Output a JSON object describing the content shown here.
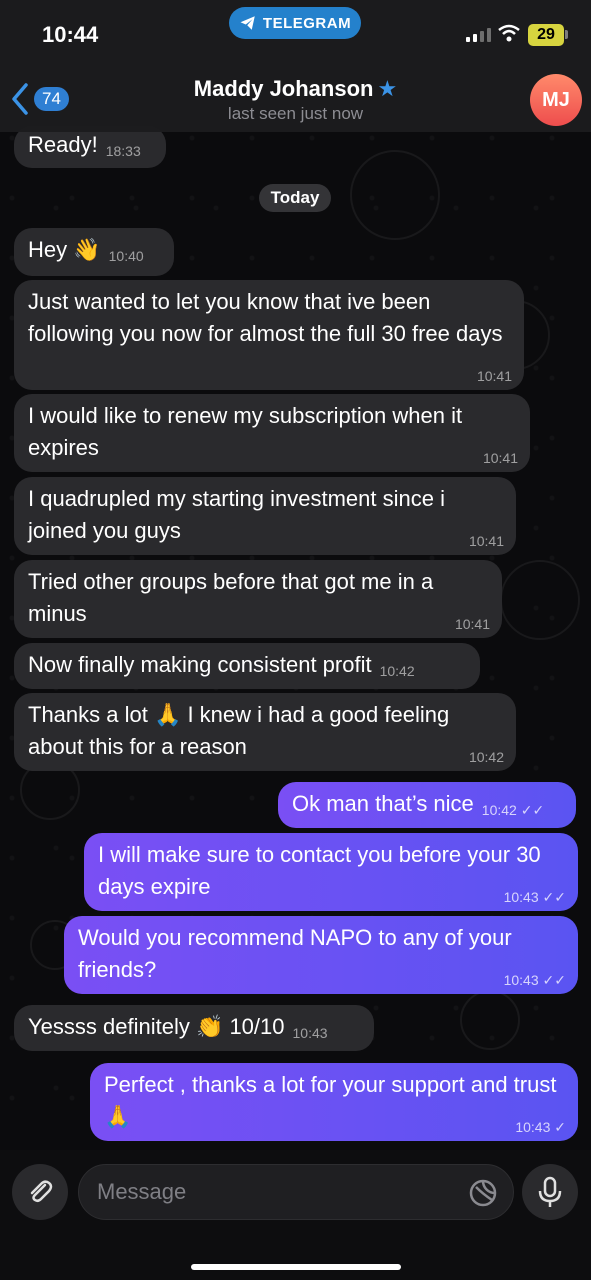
{
  "status_bar": {
    "time": "10:44",
    "telegram_label": "TELEGRAM",
    "battery": "29"
  },
  "header": {
    "back_count": "74",
    "contact_name": "Maddy Johanson",
    "contact_status": "last seen just now",
    "avatar_initials": "MJ"
  },
  "chat": {
    "date_label": "Today",
    "messages": [
      {
        "dir": "in",
        "text": "Ready!",
        "time": "18:33"
      },
      {
        "dir": "in",
        "text": "Hey 👋",
        "time": "10:40"
      },
      {
        "dir": "in",
        "text": "Just wanted to let you know that ive been following you now for almost the full 30 free days",
        "time": "10:41"
      },
      {
        "dir": "in",
        "text": "I would like to renew my subscription when it expires",
        "time": "10:41"
      },
      {
        "dir": "in",
        "text": "I quadrupled my starting investment since i joined you guys",
        "time": "10:41"
      },
      {
        "dir": "in",
        "text": "Tried other groups before that got me in a minus",
        "time": "10:41"
      },
      {
        "dir": "in",
        "text": "Now finally making consistent profit",
        "time": "10:42"
      },
      {
        "dir": "in",
        "text": "Thanks a lot 🙏 I knew i had a good feeling about this for a reason",
        "time": "10:42"
      },
      {
        "dir": "out",
        "text": "Ok man that’s nice",
        "time": "10:42",
        "ticks": "✓✓"
      },
      {
        "dir": "out",
        "text": "I will make sure to contact you before your 30 days expire",
        "time": "10:43",
        "ticks": "✓✓"
      },
      {
        "dir": "out",
        "text": "Would you recommend NAPO to any of your friends?",
        "time": "10:43",
        "ticks": "✓✓"
      },
      {
        "dir": "in",
        "text": "Yessss definitely 👏 10/10",
        "time": "10:43"
      },
      {
        "dir": "out",
        "text": "Perfect , thanks a lot for your support and trust 🙏",
        "time": "10:43",
        "ticks": "✓"
      }
    ]
  },
  "composer": {
    "placeholder": "Message"
  },
  "colors": {
    "incoming_bubble": "#2a2a2d",
    "outgoing_bubble": "#6c4ef5",
    "accent": "#2481cc"
  }
}
